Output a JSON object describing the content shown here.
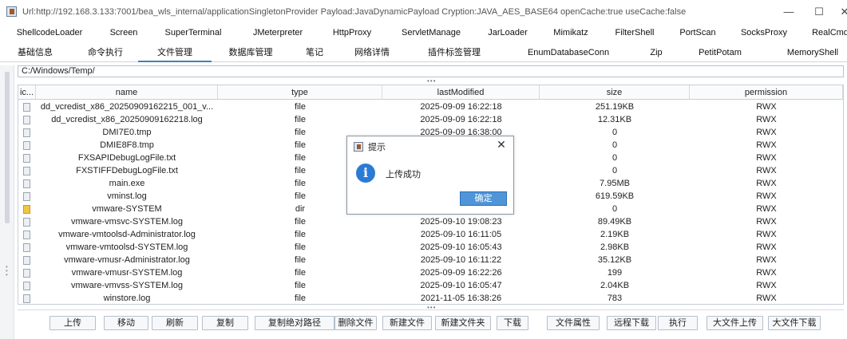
{
  "window": {
    "title": "Url:http://192.168.3.133:7001/bea_wls_internal/applicationSingletonProvider Payload:JavaDynamicPayload Cryption:JAVA_AES_BASE64 openCache:true useCache:false",
    "minimize": "—",
    "maximize": "☐",
    "close": "✕"
  },
  "tabs_row1": [
    "ShellcodeLoader",
    "Screen",
    "SuperTerminal",
    "JMeterpreter",
    "HttpProxy",
    "ServletManage",
    "JarLoader",
    "Mimikatz",
    "FilterShell",
    "PortScan",
    "SocksProxy",
    "RealCmd"
  ],
  "tabs_row2": [
    "基础信息",
    "命令执行",
    "文件管理",
    "数据库管理",
    "笔记",
    "网络详情",
    "插件标签管理",
    "EnumDatabaseConn",
    "Zip",
    "PetitPotam",
    "MemoryShell"
  ],
  "active_tab": "文件管理",
  "path": "C:/Windows/Temp/",
  "divider_dots": "•••",
  "table": {
    "headers": [
      "ic...",
      "name",
      "type",
      "lastModified",
      "size",
      "permission"
    ],
    "rows": [
      {
        "icon": "file-icon",
        "name": "dd_vcredist_x86_20250909162215_001_v...",
        "type": "file",
        "modified": "2025-09-09 16:22:18",
        "size": "251.19KB",
        "perm": "RWX"
      },
      {
        "icon": "file-icon",
        "name": "dd_vcredist_x86_20250909162218.log",
        "type": "file",
        "modified": "2025-09-09 16:22:18",
        "size": "12.31KB",
        "perm": "RWX"
      },
      {
        "icon": "file-icon",
        "name": "DMI7E0.tmp",
        "type": "file",
        "modified": "2025-09-09 16:38:00",
        "size": "0",
        "perm": "RWX"
      },
      {
        "icon": "file-icon",
        "name": "DMIE8F8.tmp",
        "type": "file",
        "modified": "",
        "size": "0",
        "perm": "RWX"
      },
      {
        "icon": "file-icon",
        "name": "FXSAPIDebugLogFile.txt",
        "type": "file",
        "modified": "",
        "size": "0",
        "perm": "RWX"
      },
      {
        "icon": "file-icon",
        "name": "FXSTIFFDebugLogFile.txt",
        "type": "file",
        "modified": "",
        "size": "0",
        "perm": "RWX"
      },
      {
        "icon": "file-icon",
        "name": "main.exe",
        "type": "file",
        "modified": "",
        "size": "7.95MB",
        "perm": "RWX"
      },
      {
        "icon": "file-icon",
        "name": "vminst.log",
        "type": "file",
        "modified": "",
        "size": "619.59KB",
        "perm": "RWX"
      },
      {
        "icon": "folder-icon",
        "name": "vmware-SYSTEM",
        "type": "dir",
        "modified": "",
        "size": "0",
        "perm": "RWX"
      },
      {
        "icon": "file-icon",
        "name": "vmware-vmsvc-SYSTEM.log",
        "type": "file",
        "modified": "2025-09-10 19:08:23",
        "size": "89.49KB",
        "perm": "RWX"
      },
      {
        "icon": "file-icon",
        "name": "vmware-vmtoolsd-Administrator.log",
        "type": "file",
        "modified": "2025-09-10 16:11:05",
        "size": "2.19KB",
        "perm": "RWX"
      },
      {
        "icon": "file-icon",
        "name": "vmware-vmtoolsd-SYSTEM.log",
        "type": "file",
        "modified": "2025-09-10 16:05:43",
        "size": "2.98KB",
        "perm": "RWX"
      },
      {
        "icon": "file-icon",
        "name": "vmware-vmusr-Administrator.log",
        "type": "file",
        "modified": "2025-09-10 16:11:22",
        "size": "35.12KB",
        "perm": "RWX"
      },
      {
        "icon": "file-icon",
        "name": "vmware-vmusr-SYSTEM.log",
        "type": "file",
        "modified": "2025-09-09 16:22:26",
        "size": "199",
        "perm": "RWX"
      },
      {
        "icon": "file-icon",
        "name": "vmware-vmvss-SYSTEM.log",
        "type": "file",
        "modified": "2025-09-10 16:05:47",
        "size": "2.04KB",
        "perm": "RWX"
      },
      {
        "icon": "file-icon",
        "name": "winstore.log",
        "type": "file",
        "modified": "2021-11-05 16:38:26",
        "size": "783",
        "perm": "RWX"
      }
    ]
  },
  "dialog": {
    "title": "提示",
    "close": "✕",
    "icon": "info-icon",
    "info_glyph": "i",
    "message": "上传成功",
    "ok": "确定"
  },
  "buttons": [
    "上传",
    "移动",
    "刷新",
    "复制",
    "复制绝对路径",
    "删除文件",
    "新建文件",
    "新建文件夹",
    "下载",
    "文件属性",
    "远程下载",
    "执行",
    "大文件上传",
    "大文件下载"
  ]
}
